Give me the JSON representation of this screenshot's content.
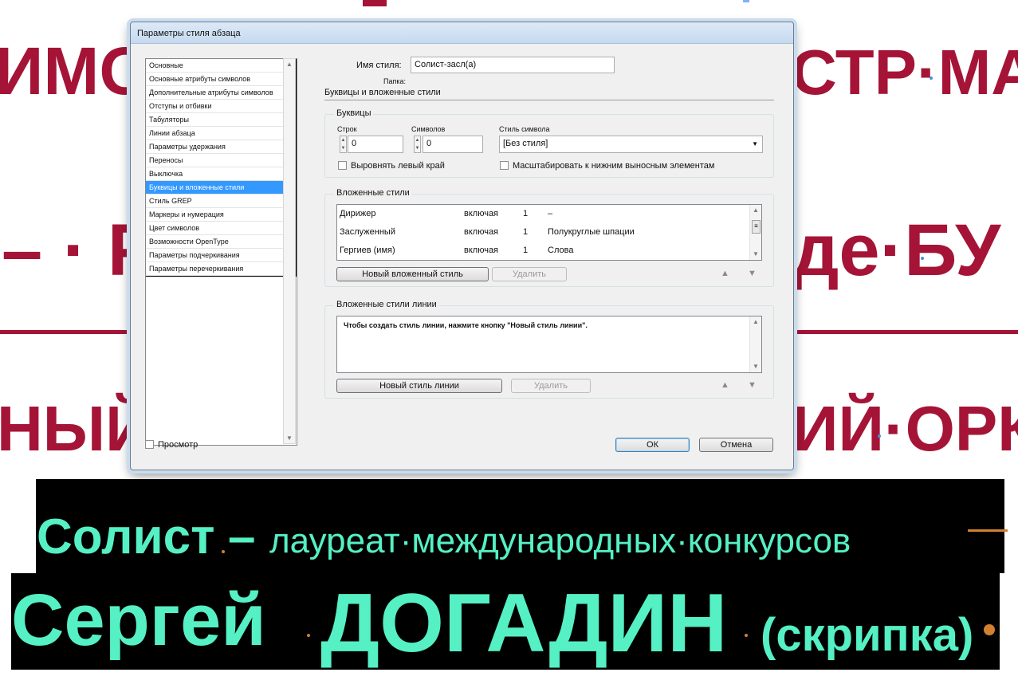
{
  "background": {
    "line1_left": "ИМО",
    "line1_right": "СТР·МА",
    "line2_left": "– · Ра",
    "line2_right": "де·БУ",
    "line3_left": "НЫЙ",
    "line3_right": "ИЙ·ОРК",
    "soloist_line": {
      "bold": "Солист",
      "dash": "–",
      "rest": "лауреат·международных·конкурсов"
    },
    "name_line": {
      "first": "Сергей",
      "last": "ДОГАДИН",
      "instrument": "(скрипка)"
    }
  },
  "dialog": {
    "title": "Параметры стиля абзаца",
    "nav_items": [
      "Основные",
      "Основные атрибуты символов",
      "Дополнительные атрибуты символов",
      "Отступы и отбивки",
      "Табуляторы",
      "Линии абзаца",
      "Параметры удержания",
      "Переносы",
      "Выключка",
      "Буквицы и вложенные стили",
      "Стиль GREP",
      "Маркеры и нумерация",
      "Цвет символов",
      "Возможности OpenType",
      "Параметры подчеркивания",
      "Параметры перечеркивания"
    ],
    "selected_nav_index": 9,
    "style_name_label": "Имя стиля:",
    "style_name_value": "Солист-засл(а)",
    "folder_label": "Папка:",
    "section_title": "Буквицы и вложенные стили",
    "drop_caps": {
      "title": "Буквицы",
      "lines_label": "Строк",
      "lines_value": "0",
      "chars_label": "Символов",
      "chars_value": "0",
      "char_style_label": "Стиль символа",
      "char_style_value": "[Без стиля]",
      "align_left": "Выровнять левый край",
      "scale_descenders": "Масштабировать к нижним выносным элементам"
    },
    "nested_styles": {
      "title": "Вложенные стили",
      "rows": [
        {
          "style": "Дирижер",
          "mode": "включая",
          "count": "1",
          "until": "–"
        },
        {
          "style": "Заслуженный",
          "mode": "включая",
          "count": "1",
          "until": "Полукруглые шпации"
        },
        {
          "style": "Гергиев (имя)",
          "mode": "включая",
          "count": "1",
          "until": "Слова"
        }
      ],
      "new_button": "Новый вложенный стиль",
      "delete_button": "Удалить"
    },
    "nested_line_styles": {
      "title": "Вложенные стили линии",
      "hint": "Чтобы создать стиль линии, нажмите кнопку \"Новый стиль линии\".",
      "new_button": "Новый стиль линии",
      "delete_button": "Удалить"
    },
    "preview_label": "Просмотр",
    "ok_button": "ОК",
    "cancel_button": "Отмена"
  }
}
